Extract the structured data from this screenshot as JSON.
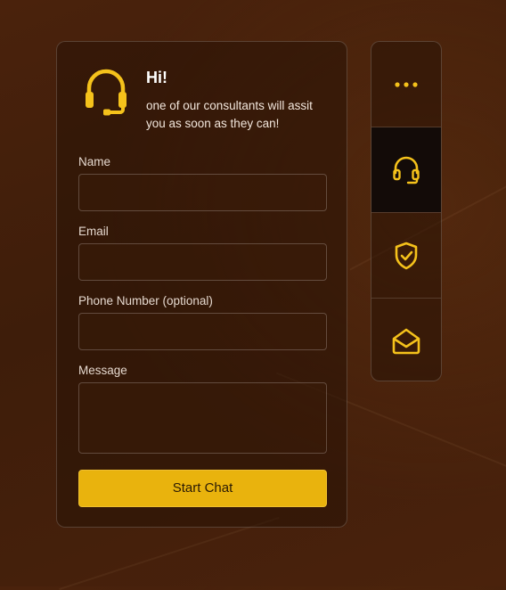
{
  "widget": {
    "greeting": "Hi!",
    "subtext": "one of our consultants will assit you as soon as they can!",
    "icon": "headset-icon"
  },
  "form": {
    "name_label": "Name",
    "name_value": "",
    "email_label": "Email",
    "email_value": "",
    "phone_label": "Phone Number (optional)",
    "phone_value": "",
    "message_label": "Message",
    "message_value": "",
    "submit_label": "Start Chat"
  },
  "sidebar": {
    "items": [
      {
        "icon": "more-dots-icon",
        "active": false
      },
      {
        "icon": "headset-icon",
        "active": true
      },
      {
        "icon": "shield-check-icon",
        "active": false
      },
      {
        "icon": "mail-open-icon",
        "active": false
      }
    ]
  },
  "colors": {
    "accent": "#e9b30d",
    "icon": "#f5c21b",
    "background": "#45200b",
    "active_tab": "#130b08"
  }
}
